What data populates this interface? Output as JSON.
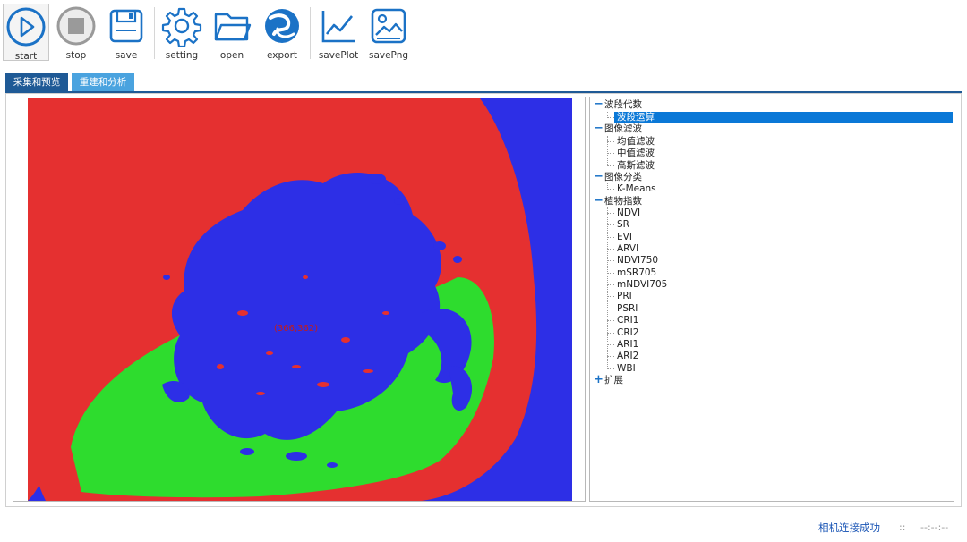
{
  "toolbar": {
    "start": "start",
    "stop": "stop",
    "save": "save",
    "setting": "setting",
    "open": "open",
    "export": "export",
    "save_plot": "savePlot",
    "save_png": "savePng"
  },
  "tabs": [
    "采集和预览",
    "重建和分析"
  ],
  "image": {
    "coordinate_text": "(366,362)",
    "colors": {
      "red": "#e53030",
      "green": "#2edc2e",
      "blue": "#2d2fe6"
    }
  },
  "tree": {
    "groups": [
      {
        "label": "波段代数",
        "expanded": true,
        "items": [
          "波段运算"
        ]
      },
      {
        "label": "图像滤波",
        "expanded": true,
        "items": [
          "均值滤波",
          "中值滤波",
          "高斯滤波"
        ]
      },
      {
        "label": "图像分类",
        "expanded": true,
        "items": [
          "K-Means"
        ]
      },
      {
        "label": "植物指数",
        "expanded": true,
        "items": [
          "NDVI",
          "SR",
          "EVI",
          "ARVI",
          "NDVI750",
          "mSR705",
          "mNDVI705",
          "PRI",
          "PSRI",
          "CRI1",
          "CRI2",
          "ARI1",
          "ARI2",
          "WBI"
        ]
      },
      {
        "label": "扩展",
        "expanded": false,
        "items": []
      }
    ],
    "selected": "波段运算",
    "toggle_expanded": "−",
    "toggle_collapsed": "+"
  },
  "status": {
    "message": "相机连接成功",
    "separator": "::",
    "time": "--:--:--"
  },
  "accent": "#1b72c6"
}
